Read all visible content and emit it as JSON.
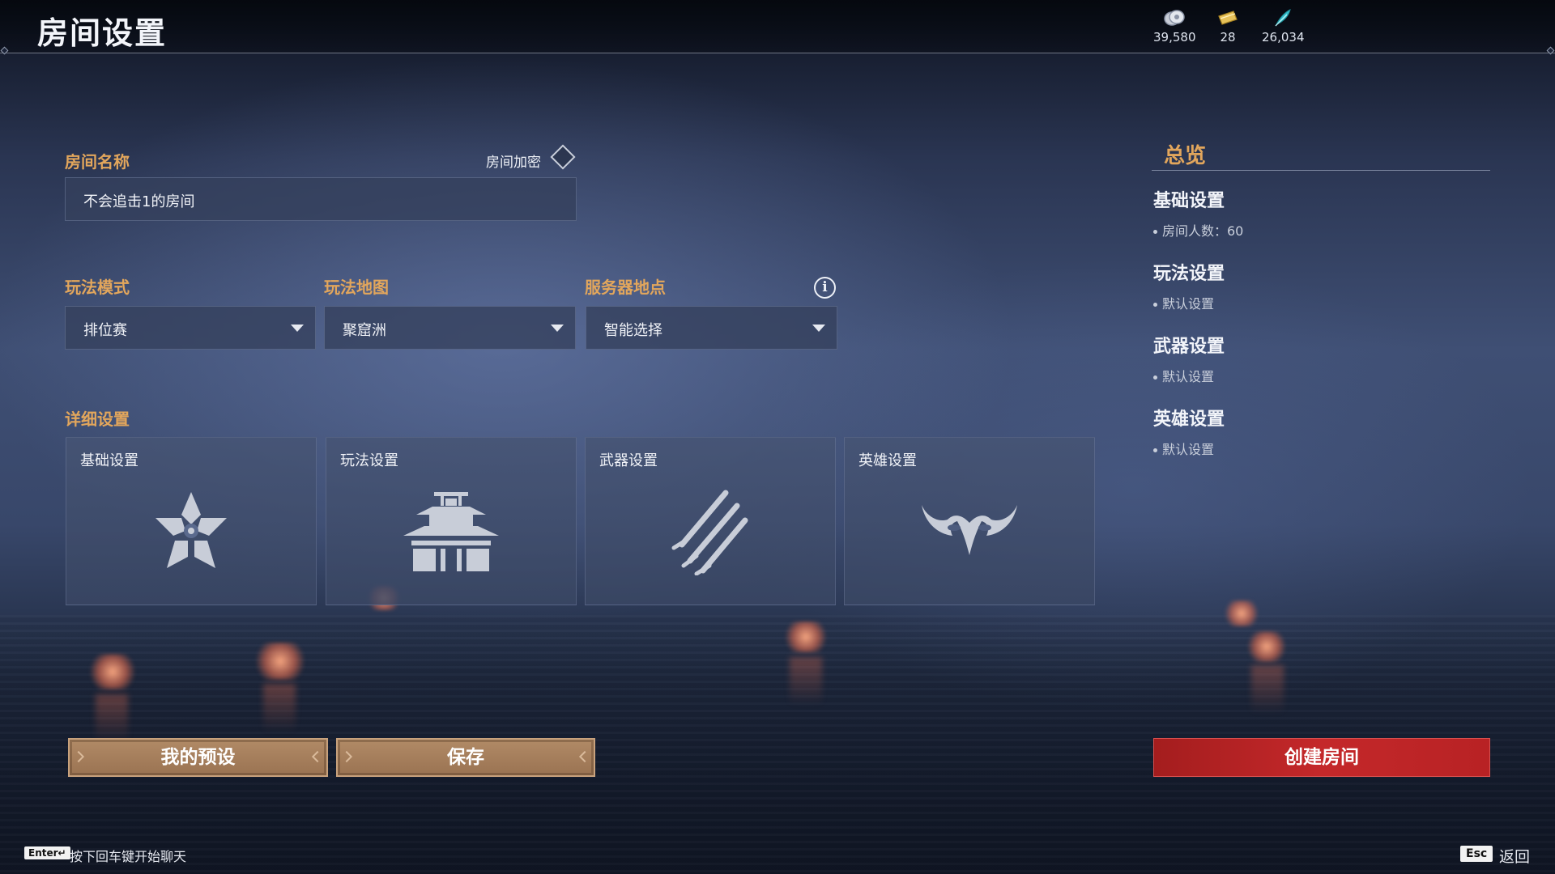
{
  "header": {
    "title": "房间设置",
    "currencies": [
      {
        "icon": "coin-icon",
        "value": "39,580"
      },
      {
        "icon": "ticket-icon",
        "value": "28"
      },
      {
        "icon": "feather-icon",
        "value": "26,034"
      }
    ]
  },
  "form": {
    "room_name_label": "房间名称",
    "room_name_value": "不会追击1的房间",
    "encrypt_label": "房间加密",
    "mode_label": "玩法模式",
    "mode_value": "排位赛",
    "map_label": "玩法地图",
    "map_value": "聚窟洲",
    "server_label": "服务器地点",
    "server_value": "智能选择"
  },
  "details": {
    "label": "详细设置",
    "cards": [
      {
        "title": "基础设置",
        "icon": "flower-icon"
      },
      {
        "title": "玩法设置",
        "icon": "temple-icon"
      },
      {
        "title": "武器设置",
        "icon": "swords-icon"
      },
      {
        "title": "英雄设置",
        "icon": "mask-icon"
      }
    ]
  },
  "overview": {
    "title": "总览",
    "sections": [
      {
        "title": "基础设置",
        "item": "房间人数：60"
      },
      {
        "title": "玩法设置",
        "item": "默认设置"
      },
      {
        "title": "武器设置",
        "item": "默认设置"
      },
      {
        "title": "英雄设置",
        "item": "默认设置"
      }
    ]
  },
  "buttons": {
    "presets": "我的预设",
    "save": "保存",
    "create": "创建房间"
  },
  "footer": {
    "enter_key": "Enter↵",
    "chat_hint": "按下回车键开始聊天",
    "esc_key": "Esc",
    "back": "返回"
  },
  "colors": {
    "accent_gold": "#e2a65c",
    "create_red": "#c4282a",
    "button_tan": "#a47c5a"
  }
}
